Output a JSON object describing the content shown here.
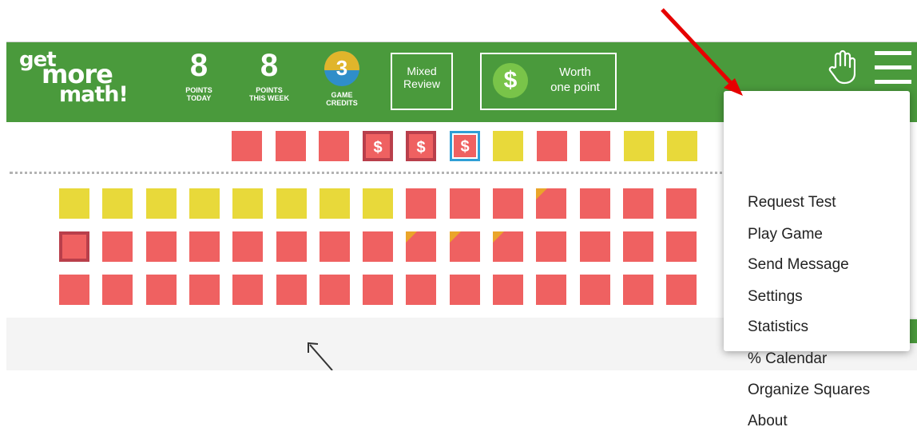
{
  "header": {
    "logo_lines": [
      "get",
      "more",
      "math!"
    ],
    "points_today": {
      "value": "8",
      "caption": "POINTS\nTODAY"
    },
    "points_week": {
      "value": "8",
      "caption": "POINTS\nTHIS WEEK"
    },
    "game_credits": {
      "value": "3",
      "caption": "GAME\nCREDITS"
    },
    "mixed_review_label": "Mixed\nReview",
    "worth": {
      "symbol": "$",
      "label": "Worth\none point"
    }
  },
  "icons": {
    "hand": "hand-pointer-icon",
    "menu": "hamburger-menu-icon"
  },
  "squares": {
    "top_row": [
      "red",
      "red",
      "red",
      "dollar",
      "dollar",
      "dollar-current",
      "yellow",
      "red",
      "red",
      "yellow",
      "yellow"
    ],
    "rows": [
      [
        "yellow",
        "yellow",
        "yellow",
        "yellow",
        "yellow",
        "yellow",
        "yellow",
        "yellow",
        "red",
        "red",
        "red",
        "red-corner",
        "red",
        "red",
        "red",
        "red"
      ],
      [
        "red-current",
        "red",
        "red",
        "red",
        "red",
        "red",
        "red",
        "red",
        "red-corner",
        "red-corner",
        "red-corner",
        "red",
        "red",
        "red",
        "red",
        "red"
      ],
      [
        "red",
        "red",
        "red",
        "red",
        "red",
        "red",
        "red",
        "red",
        "red",
        "red",
        "red",
        "red",
        "red",
        "red",
        "red",
        "red"
      ]
    ]
  },
  "dollar_symbol": "$",
  "menu": {
    "items": [
      "Request Test",
      "Play Game",
      "Send Message",
      "Settings",
      "Statistics",
      "% Calendar",
      "Organize Squares",
      "About"
    ]
  },
  "colors": {
    "header_green": "#4a9a3c",
    "square_red": "#ef6161",
    "square_yellow": "#e8d93a",
    "dark_border": "#b93f4b",
    "current_blue": "#2f9fd6",
    "corner_orange": "#eaa52a",
    "annotation_red": "#e60000"
  }
}
